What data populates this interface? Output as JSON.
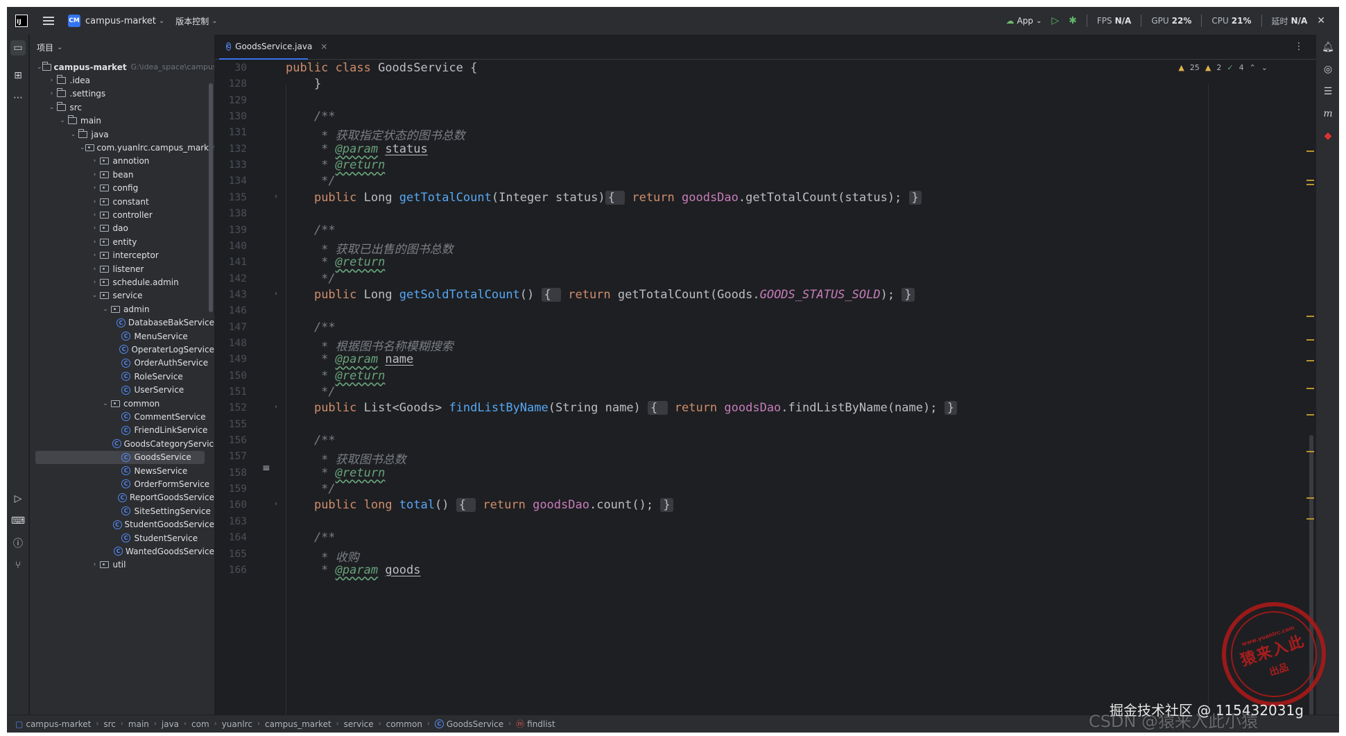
{
  "titlebar": {
    "logo": "IJ",
    "project_badge": "CM",
    "project_name": "campus-market",
    "vcs": "版本控制",
    "run_config": "App",
    "metrics": [
      {
        "label": "FPS",
        "value": "N/A"
      },
      {
        "label": "GPU",
        "value": "22%"
      },
      {
        "label": "CPU",
        "value": "21%"
      },
      {
        "label": "延时",
        "value": "N/A"
      }
    ]
  },
  "project_panel": {
    "title": "项目",
    "items": [
      {
        "depth": 0,
        "type": "module",
        "label": "campus-market",
        "hint": "G:\\idea_space\\campus-market",
        "expanded": true
      },
      {
        "depth": 1,
        "type": "folder",
        "label": ".idea",
        "expanded": false
      },
      {
        "depth": 1,
        "type": "folder",
        "label": ".settings",
        "expanded": false
      },
      {
        "depth": 1,
        "type": "folder",
        "label": "src",
        "expanded": true
      },
      {
        "depth": 2,
        "type": "folder",
        "label": "main",
        "expanded": true
      },
      {
        "depth": 3,
        "type": "folder",
        "label": "java",
        "expanded": true
      },
      {
        "depth": 4,
        "type": "package",
        "label": "com.yuanlrc.campus_market",
        "expanded": true
      },
      {
        "depth": 5,
        "type": "package",
        "label": "annotion",
        "expanded": false
      },
      {
        "depth": 5,
        "type": "package",
        "label": "bean",
        "expanded": false
      },
      {
        "depth": 5,
        "type": "package",
        "label": "config",
        "expanded": false
      },
      {
        "depth": 5,
        "type": "package",
        "label": "constant",
        "expanded": false
      },
      {
        "depth": 5,
        "type": "package",
        "label": "controller",
        "expanded": false
      },
      {
        "depth": 5,
        "type": "package",
        "label": "dao",
        "expanded": false
      },
      {
        "depth": 5,
        "type": "package",
        "label": "entity",
        "expanded": false
      },
      {
        "depth": 5,
        "type": "package",
        "label": "interceptor",
        "expanded": false
      },
      {
        "depth": 5,
        "type": "package",
        "label": "listener",
        "expanded": false
      },
      {
        "depth": 5,
        "type": "package",
        "label": "schedule.admin",
        "expanded": false
      },
      {
        "depth": 5,
        "type": "package",
        "label": "service",
        "expanded": true
      },
      {
        "depth": 6,
        "type": "package",
        "label": "admin",
        "expanded": true
      },
      {
        "depth": 7,
        "type": "class",
        "label": "DatabaseBakService"
      },
      {
        "depth": 7,
        "type": "class",
        "label": "MenuService"
      },
      {
        "depth": 7,
        "type": "class",
        "label": "OperaterLogService"
      },
      {
        "depth": 7,
        "type": "class",
        "label": "OrderAuthService"
      },
      {
        "depth": 7,
        "type": "class",
        "label": "RoleService"
      },
      {
        "depth": 7,
        "type": "class",
        "label": "UserService"
      },
      {
        "depth": 6,
        "type": "package",
        "label": "common",
        "expanded": true
      },
      {
        "depth": 7,
        "type": "class",
        "label": "CommentService"
      },
      {
        "depth": 7,
        "type": "class",
        "label": "FriendLinkService"
      },
      {
        "depth": 7,
        "type": "class",
        "label": "GoodsCategoryService"
      },
      {
        "depth": 7,
        "type": "class",
        "label": "GoodsService",
        "selected": true
      },
      {
        "depth": 7,
        "type": "class",
        "label": "NewsService"
      },
      {
        "depth": 7,
        "type": "class",
        "label": "OrderFormService"
      },
      {
        "depth": 7,
        "type": "class",
        "label": "ReportGoodsService"
      },
      {
        "depth": 7,
        "type": "class",
        "label": "SiteSettingService"
      },
      {
        "depth": 7,
        "type": "class",
        "label": "StudentGoodsService"
      },
      {
        "depth": 7,
        "type": "class",
        "label": "StudentService"
      },
      {
        "depth": 7,
        "type": "class",
        "label": "WantedGoodsService"
      },
      {
        "depth": 5,
        "type": "package",
        "label": "util",
        "expanded": false
      }
    ]
  },
  "editor": {
    "tab": {
      "label": "GoodsService.java"
    },
    "inspections": {
      "warnings": "25",
      "weak_warnings": "2",
      "ok": "4"
    },
    "lines": [
      {
        "n": "30",
        "tokens": [
          [
            "kw",
            "public "
          ],
          [
            "kw",
            "class "
          ],
          [
            "",
            "GoodsService {"
          ]
        ]
      },
      {
        "n": "128",
        "tokens": [
          [
            "",
            "    }"
          ]
        ]
      },
      {
        "n": "129",
        "tokens": []
      },
      {
        "n": "130",
        "tokens": [
          [
            "cmt",
            "    /**"
          ]
        ]
      },
      {
        "n": "131",
        "tokens": [
          [
            "cmt",
            "     * 获取指定状态的图书总数"
          ]
        ]
      },
      {
        "n": "132",
        "tokens": [
          [
            "cmt",
            "     * "
          ],
          [
            "tag",
            "@param"
          ],
          [
            "cmt",
            " "
          ],
          [
            "par",
            "status"
          ]
        ]
      },
      {
        "n": "133",
        "tokens": [
          [
            "cmt",
            "     * "
          ],
          [
            "tag",
            "@return"
          ]
        ]
      },
      {
        "n": "134",
        "tokens": [
          [
            "cmt",
            "     */"
          ]
        ]
      },
      {
        "n": "135",
        "fold": true,
        "tokens": [
          [
            "",
            "    "
          ],
          [
            "kw",
            "public "
          ],
          [
            "",
            "Long "
          ],
          [
            "fn",
            "getTotalCount"
          ],
          [
            "",
            "(Integer status)"
          ],
          [
            "collapsed",
            "{ "
          ],
          [
            "kw",
            " return "
          ],
          [
            "fld",
            "goodsDao"
          ],
          [
            "",
            ".getTotalCount(status); "
          ],
          [
            "collapsed",
            "}"
          ]
        ]
      },
      {
        "n": "138",
        "tokens": []
      },
      {
        "n": "139",
        "tokens": [
          [
            "cmt",
            "    /**"
          ]
        ]
      },
      {
        "n": "140",
        "tokens": [
          [
            "cmt",
            "     * 获取已出售的图书总数"
          ]
        ]
      },
      {
        "n": "141",
        "tokens": [
          [
            "cmt",
            "     * "
          ],
          [
            "tag",
            "@return"
          ]
        ]
      },
      {
        "n": "142",
        "tokens": [
          [
            "cmt",
            "     */"
          ]
        ]
      },
      {
        "n": "143",
        "fold": true,
        "tokens": [
          [
            "",
            "    "
          ],
          [
            "kw",
            "public "
          ],
          [
            "",
            "Long "
          ],
          [
            "fn",
            "getSoldTotalCount"
          ],
          [
            "",
            "() "
          ],
          [
            "collapsed",
            "{ "
          ],
          [
            "kw",
            " return "
          ],
          [
            "",
            "getTotalCount(Goods."
          ],
          [
            "cn",
            "GOODS_STATUS_SOLD"
          ],
          [
            "",
            "); "
          ],
          [
            "collapsed",
            "}"
          ]
        ]
      },
      {
        "n": "146",
        "tokens": []
      },
      {
        "n": "147",
        "tokens": [
          [
            "cmt",
            "    /**"
          ]
        ]
      },
      {
        "n": "148",
        "tokens": [
          [
            "cmt",
            "     * 根据图书名称模糊搜索"
          ]
        ]
      },
      {
        "n": "149",
        "tokens": [
          [
            "cmt",
            "     * "
          ],
          [
            "tag",
            "@param"
          ],
          [
            "cmt",
            " "
          ],
          [
            "par",
            "name"
          ]
        ]
      },
      {
        "n": "150",
        "tokens": [
          [
            "cmt",
            "     * "
          ],
          [
            "tag",
            "@return"
          ]
        ]
      },
      {
        "n": "151",
        "tokens": [
          [
            "cmt",
            "     */"
          ]
        ]
      },
      {
        "n": "152",
        "fold": true,
        "tokens": [
          [
            "",
            "    "
          ],
          [
            "kw",
            "public "
          ],
          [
            "",
            "List<Goods> "
          ],
          [
            "fn",
            "findListByName"
          ],
          [
            "",
            "(String name) "
          ],
          [
            "collapsed",
            "{ "
          ],
          [
            "kw",
            " return "
          ],
          [
            "fld",
            "goodsDao"
          ],
          [
            "",
            ".findListByName(name); "
          ],
          [
            "collapsed",
            "}"
          ]
        ]
      },
      {
        "n": "155",
        "tokens": []
      },
      {
        "n": "156",
        "tokens": [
          [
            "cmt",
            "    /**"
          ]
        ]
      },
      {
        "n": "157",
        "tokens": [
          [
            "cmt",
            "     * 获取图书总数"
          ]
        ]
      },
      {
        "n": "158",
        "tokens": [
          [
            "cmt",
            "     * "
          ],
          [
            "tag",
            "@return"
          ]
        ]
      },
      {
        "n": "159",
        "tokens": [
          [
            "cmt",
            "     */"
          ]
        ]
      },
      {
        "n": "160",
        "fold": true,
        "tokens": [
          [
            "",
            "    "
          ],
          [
            "kw",
            "public "
          ],
          [
            "kw",
            "long "
          ],
          [
            "fn",
            "total"
          ],
          [
            "",
            "() "
          ],
          [
            "collapsed",
            "{ "
          ],
          [
            "kw",
            " return "
          ],
          [
            "fld",
            "goodsDao"
          ],
          [
            "",
            ".count(); "
          ],
          [
            "collapsed",
            "}"
          ]
        ]
      },
      {
        "n": "163",
        "tokens": []
      },
      {
        "n": "164",
        "tokens": [
          [
            "cmt",
            "    /**"
          ]
        ]
      },
      {
        "n": "165",
        "tokens": [
          [
            "cmt",
            "     * 收购"
          ]
        ]
      },
      {
        "n": "166",
        "tokens": [
          [
            "cmt",
            "     * "
          ],
          [
            "tag",
            "@param"
          ],
          [
            "cmt",
            " "
          ],
          [
            "par",
            "goods"
          ]
        ]
      }
    ]
  },
  "statusbar": {
    "crumbs": [
      "campus-market",
      "src",
      "main",
      "java",
      "com",
      "yuanlrc",
      "campus_market",
      "service",
      "common",
      "GoodsService",
      "findlist"
    ]
  },
  "watermark": {
    "text": "掘金技术社区 @ 115432031g",
    "text2": "CSDN @猿来入此小猿",
    "stamp_main": "猿来入此",
    "stamp_sub": "出品",
    "stamp_url": "www.yuanlrc.com"
  },
  "colors": {
    "accent": "#3574f0",
    "keyword": "#cf8e6d",
    "function": "#56a8f5",
    "field": "#c77dbb",
    "comment": "#7a7e85",
    "doc_tag": "#67a37c"
  }
}
